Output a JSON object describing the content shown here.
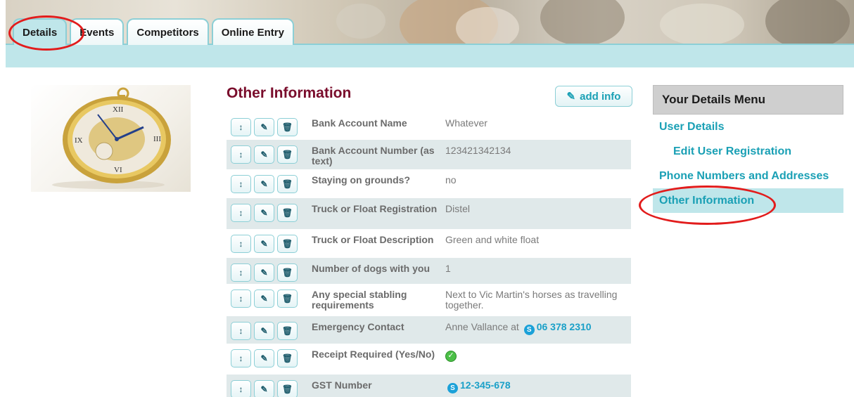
{
  "tabs": [
    {
      "label": "Details"
    },
    {
      "label": "Events"
    },
    {
      "label": "Competitors"
    },
    {
      "label": "Online Entry"
    }
  ],
  "main": {
    "title": "Other Information",
    "add_info_label": "add info",
    "rows": [
      {
        "label": "Bank Account Name",
        "value": "Whatever"
      },
      {
        "label": "Bank Account Number (as text)",
        "value": "123421342134"
      },
      {
        "label": "Staying on grounds?",
        "value": "no"
      },
      {
        "label": "Truck or Float Registration",
        "value": "Distel"
      },
      {
        "label": "Truck or Float Description",
        "value": "Green and white float"
      },
      {
        "label": "Number of dogs with you",
        "value": "1"
      },
      {
        "label": "Any special stabling requirements",
        "value": "Next to Vic Martin's horses as travelling together."
      },
      {
        "label": "Emergency Contact",
        "value_prefix": "Anne Vallance at",
        "phone": "06 378 2310"
      },
      {
        "label": "Receipt Required (Yes/No)",
        "value_icon": "check-icon"
      },
      {
        "label": "GST Number",
        "phone": "12-345-678"
      }
    ]
  },
  "side_menu": {
    "title": "Your Details Menu",
    "items": [
      {
        "label": "User Details"
      },
      {
        "label": "Edit User Registration"
      },
      {
        "label": "Phone Numbers and Addresses"
      },
      {
        "label": "Other Information"
      }
    ]
  },
  "colors": {
    "accent": "#1aa0b5",
    "title": "#7a0d2c",
    "highlight_oval": "#e21c1c",
    "tab_strip": "#bfe6ea"
  }
}
